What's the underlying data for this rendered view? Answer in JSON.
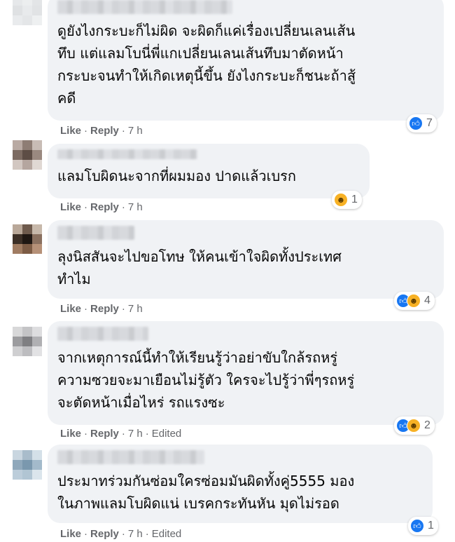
{
  "comments": [
    {
      "text": "ดูยังไงกระบะก็ไม่ผิด จะผิดก็แค่เรื่องเปลี่ยนเลนเส้น\nทึบ แต่แลมโบนี่พี่แกเปลี่ยนเลนเส้นทึบมาตัดหน้า\nกระบะจนทำให้เกิดเหตุนี้ขึ้น ยังไงกระบะก็ชนะถ้าสู้\nคดี",
      "like": "Like",
      "reply": "Reply",
      "time": "7 h",
      "edited": "",
      "reaction_count": "7",
      "reactions": [
        "like"
      ]
    },
    {
      "text": "แลมโบผิดนะจากที่ผมมอง ปาดแล้วเบรก",
      "like": "Like",
      "reply": "Reply",
      "time": "7 h",
      "edited": "",
      "reaction_count": "1",
      "reactions": [
        "haha"
      ]
    },
    {
      "text": "ลุงนิสสันจะไปขอโทษ ให้คนเข้าใจผิดทั้งประเทศ\nทำไม",
      "like": "Like",
      "reply": "Reply",
      "time": "7 h",
      "edited": "",
      "reaction_count": "4",
      "reactions": [
        "like",
        "haha"
      ]
    },
    {
      "text": "จากเหตุการณ์นี้ทำให้เรียนรู้ว่าอย่าขับใกล้รถหรู่\nความซวยจะมาเยือนไม่รู้ตัว ใครจะไปรู้ว่าพี่ๆรถหรู่\nจะตัดหน้าเมื่อไหร่ รถแรงซะ",
      "like": "Like",
      "reply": "Reply",
      "time": "7 h",
      "edited": "Edited",
      "reaction_count": "2",
      "reactions": [
        "like",
        "haha"
      ]
    },
    {
      "text": "ประมาทร่วมกันซ่อมใครซ่อมมันผิดทั้งคู่5555 มอง\nในภาพแลมโบผิดแน่ เบรคกระทันหัน มุดไม่รอด",
      "like": "Like",
      "reply": "Reply",
      "time": "7 h",
      "edited": "Edited",
      "reaction_count": "1",
      "reactions": [
        "like"
      ]
    }
  ],
  "reaction_icons": {
    "like": "thumbs-up-icon",
    "haha": "laughing-face-icon"
  },
  "colors": {
    "bubble": "#f0f2f5",
    "like_blue": "#1877f2",
    "haha_yellow": "#f7b125",
    "meta_gray": "#65676b"
  }
}
